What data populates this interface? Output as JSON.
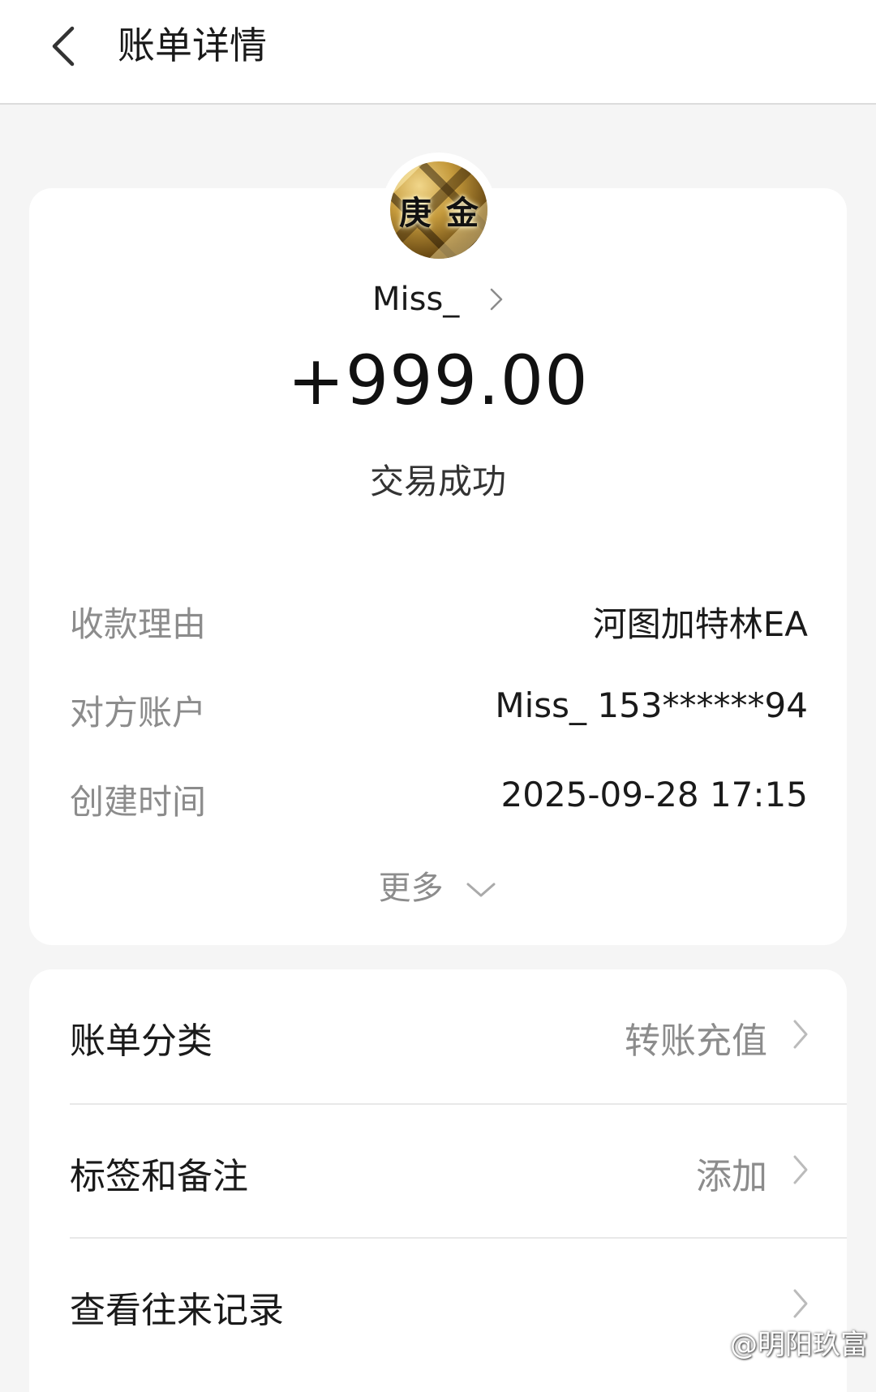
{
  "header": {
    "title": "账单详情"
  },
  "payer": {
    "avatar_text": [
      "庚",
      "金"
    ],
    "name": "Miss_"
  },
  "transaction": {
    "amount": "+999.00",
    "status": "交易成功"
  },
  "details": [
    {
      "label": "收款理由",
      "value": "河图加特林EA"
    },
    {
      "label": "对方账户",
      "value": "Miss_ 153******94"
    },
    {
      "label": "创建时间",
      "value": "2025-09-28 17:15"
    }
  ],
  "more_label": "更多",
  "options": [
    {
      "label": "账单分类",
      "value": "转账充值"
    },
    {
      "label": "标签和备注",
      "value": "添加"
    },
    {
      "label": "查看往来记录",
      "value": ""
    }
  ],
  "watermark": "@明阳玖富",
  "icons": {
    "back": "chevron-left-icon",
    "payer_link": "chevron-right-icon",
    "more": "chevron-down-icon",
    "row": "chevron-right-icon"
  }
}
